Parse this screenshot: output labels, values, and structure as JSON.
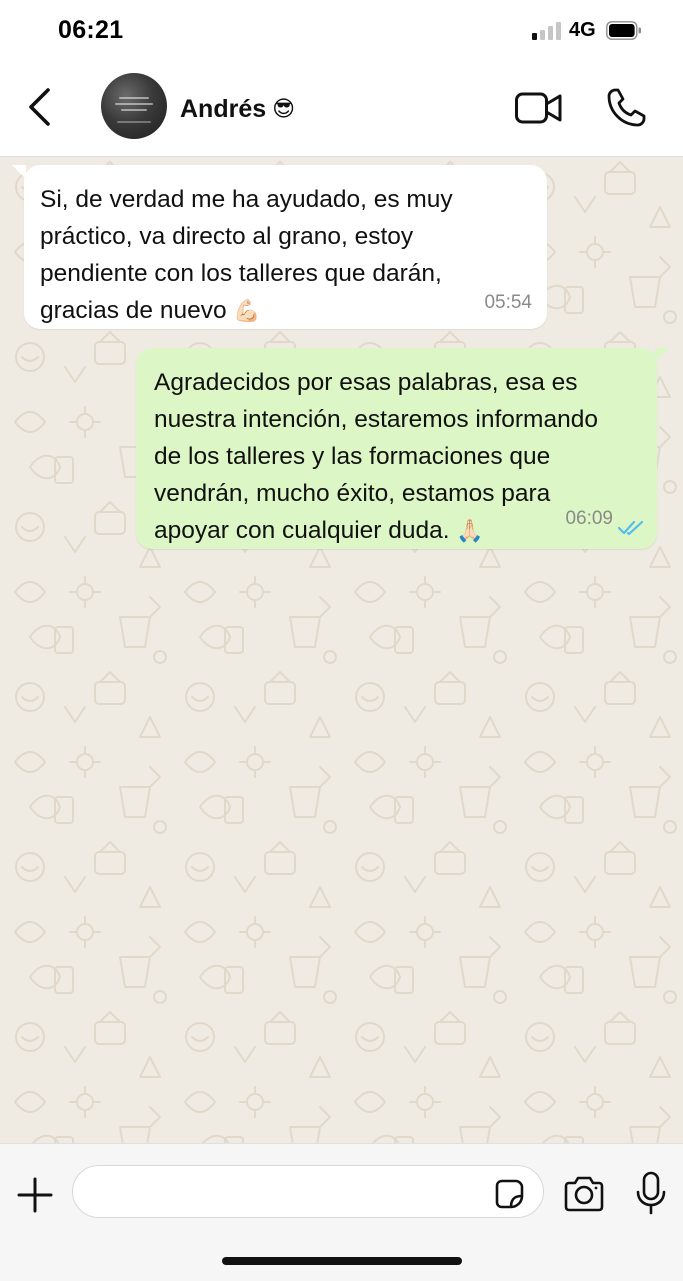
{
  "status_bar": {
    "time": "06:21",
    "network": "4G",
    "signal_bars_active": 1,
    "signal_bars_total": 4,
    "battery_level": 0.85
  },
  "header": {
    "contact_name": "Andrés",
    "contact_emoji": "😎",
    "avatar_icon": "contact-avatar",
    "back_icon": "chevron-left-icon",
    "video_icon": "video-camera-icon",
    "call_icon": "phone-icon"
  },
  "messages": [
    {
      "direction": "incoming",
      "text": "Si, de verdad me ha ayudado, es muy\npráctico, va directo al grano, estoy\npendiente con los talleres que darán,\ngracias de nuevo",
      "emoji": "💪🏻",
      "time": "05:54"
    },
    {
      "direction": "outgoing",
      "text": "Agradecidos por esas palabras, esa es\nnuestra intención, estaremos informando\nde los talleres y las formaciones que\nvendrán, mucho éxito, estamos para\napoyar con cualquier duda.",
      "emoji": "🙏🏻",
      "time": "06:09",
      "status": "read"
    }
  ],
  "input_bar": {
    "message_value": "",
    "plus_icon": "plus-icon",
    "sticker_icon": "sticker-icon",
    "camera_icon": "camera-icon",
    "mic_icon": "microphone-icon"
  },
  "colors": {
    "chat_background": "#efeae2",
    "incoming_bubble": "#ffffff",
    "outgoing_bubble": "#dcf7c5",
    "read_receipt": "#53bdeb",
    "icon": "#111111"
  }
}
